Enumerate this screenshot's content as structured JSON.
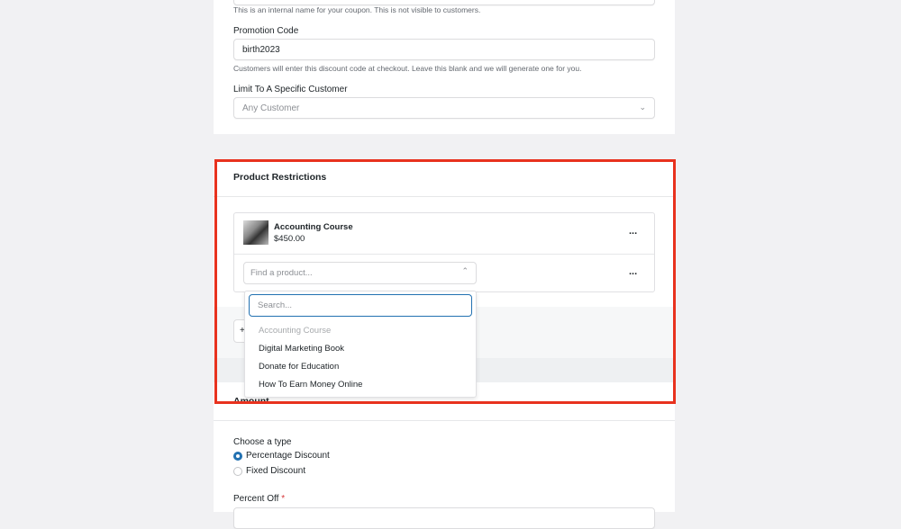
{
  "general": {
    "name_help": "This is an internal name for your coupon. This is not visible to customers.",
    "promo_label": "Promotion Code",
    "promo_value": "birth2023",
    "promo_help": "Customers will enter this discount code at checkout. Leave this blank and we will generate one for you.",
    "customer_label": "Limit To A Specific Customer",
    "customer_placeholder": "Any Customer"
  },
  "product_restrictions": {
    "title": "Product Restrictions",
    "selected_product": {
      "name": "Accounting Course",
      "price": "$450.00"
    },
    "find_placeholder": "Find a product...",
    "more_label": "...",
    "add_label": "+",
    "dropdown": {
      "search_placeholder": "Search...",
      "options": [
        {
          "label": "Accounting Course",
          "disabled": true
        },
        {
          "label": "Digital Marketing Book",
          "disabled": false
        },
        {
          "label": "Donate for Education",
          "disabled": false
        },
        {
          "label": "How To Earn Money Online",
          "disabled": false
        }
      ]
    }
  },
  "amount": {
    "title": "Amount",
    "type_label": "Choose a type",
    "types": [
      {
        "label": "Percentage Discount",
        "selected": true
      },
      {
        "label": "Fixed Discount",
        "selected": false
      }
    ],
    "percent_label": "Percent Off",
    "required_mark": "*"
  },
  "colors": {
    "highlight": "#e8321e",
    "accent": "#2271b1"
  }
}
